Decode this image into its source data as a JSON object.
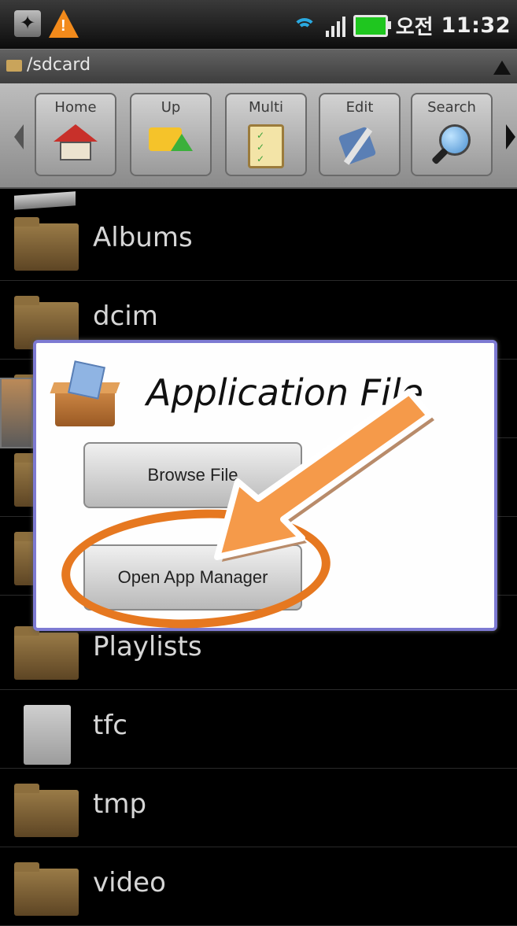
{
  "status_bar": {
    "ampm": "오전",
    "time": "11:32",
    "icons": [
      "usb-icon",
      "warning-icon",
      "wifi-icon",
      "signal-icon",
      "battery-icon"
    ]
  },
  "path_bar": {
    "path": "/sdcard"
  },
  "toolbar": {
    "buttons": [
      {
        "label": "Home",
        "icon": "home-icon"
      },
      {
        "label": "Up",
        "icon": "up-folder-icon"
      },
      {
        "label": "Multi",
        "icon": "clipboard-icon"
      },
      {
        "label": "Edit",
        "icon": "tools-icon"
      },
      {
        "label": "Search",
        "icon": "magnifier-icon"
      }
    ]
  },
  "files": [
    {
      "name": "Albums",
      "type": "folder"
    },
    {
      "name": "dcim",
      "type": "folder"
    },
    {
      "name": "Playlists",
      "type": "folder"
    },
    {
      "name": "tfc",
      "type": "file"
    },
    {
      "name": "tmp",
      "type": "folder"
    },
    {
      "name": "video",
      "type": "folder"
    }
  ],
  "dialog": {
    "title": "Application File",
    "buttons": {
      "browse": "Browse File",
      "open": "Open App Manager"
    }
  },
  "colors": {
    "accent_orange": "#e67820",
    "dialog_border": "#7d7ad2"
  }
}
